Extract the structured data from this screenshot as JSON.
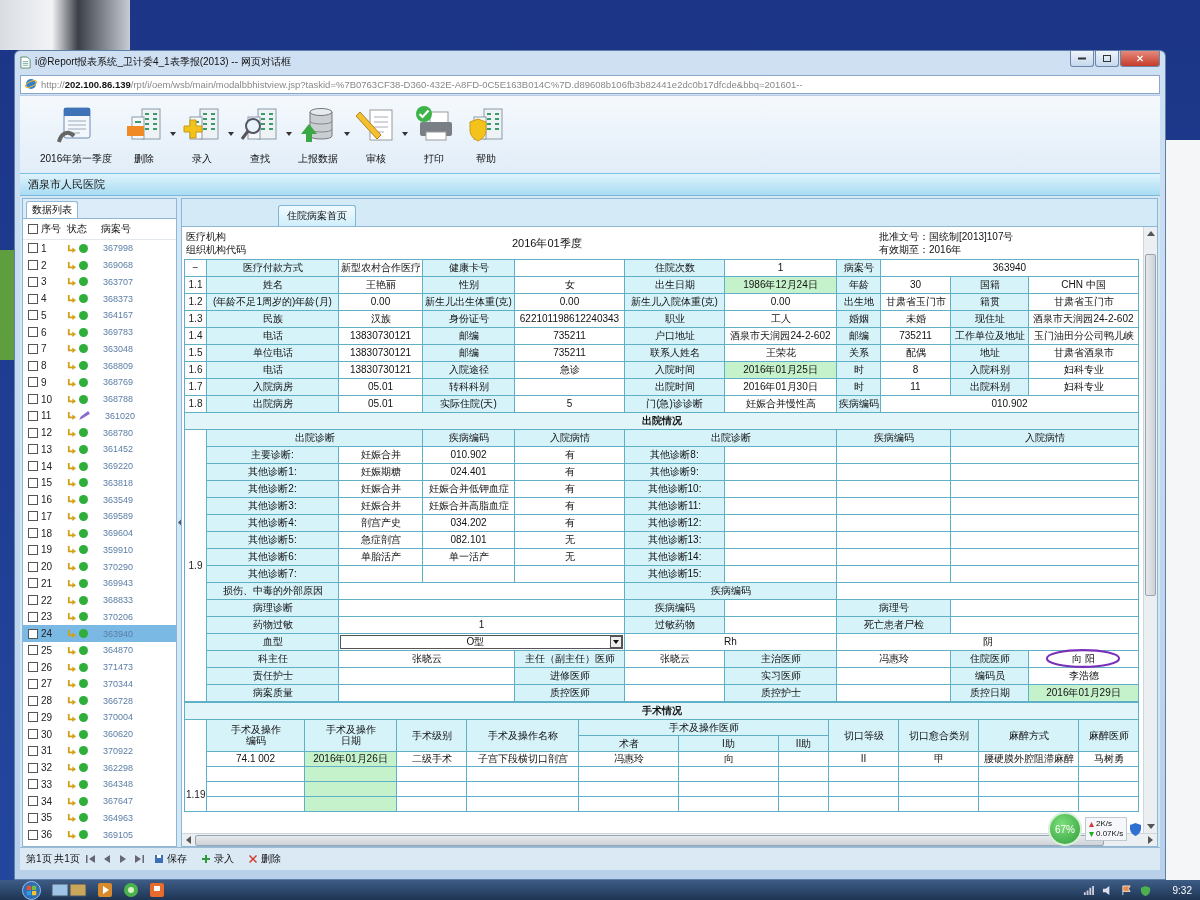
{
  "window": {
    "title": "i@Report报表系统_卫计委4_1表季报(2013) -- 网页对话框",
    "url": "http://**202.100.86.139**/rpt/i/oem/wsb/main/modalbbhistview.jsp?taskid=%7B0763CF38-D360-432E-A8FD-0C5E163B014C%7D.d89608b106fb3b82441e2dc0b17dfcde&bbq=201601--"
  },
  "toolbar": [
    {
      "label": "2016年第一季度",
      "dropdown": false
    },
    {
      "label": "删除",
      "dropdown": true
    },
    {
      "label": "录入",
      "dropdown": true
    },
    {
      "label": "查找",
      "dropdown": true
    },
    {
      "label": "上报数据",
      "dropdown": true
    },
    {
      "label": "审核",
      "dropdown": true
    },
    {
      "label": "打印",
      "dropdown": false
    },
    {
      "label": "帮助",
      "dropdown": false
    }
  ],
  "hospital": "酒泉市人民医院",
  "record_list": {
    "tab": "数据列表",
    "header_checked": false,
    "columns": [
      "序号",
      "状态",
      "病案号"
    ],
    "rows": [
      {
        "no": "1",
        "kind": "done",
        "record": "367998",
        "checked": false,
        "selected": false
      },
      {
        "no": "2",
        "kind": "done",
        "record": "369068",
        "checked": false,
        "selected": false
      },
      {
        "no": "3",
        "kind": "done",
        "record": "363707",
        "checked": false,
        "selected": false
      },
      {
        "no": "4",
        "kind": "done",
        "record": "368373",
        "checked": false,
        "selected": false
      },
      {
        "no": "5",
        "kind": "done",
        "record": "364167",
        "checked": false,
        "selected": false
      },
      {
        "no": "6",
        "kind": "done",
        "record": "369783",
        "checked": false,
        "selected": false
      },
      {
        "no": "7",
        "kind": "done",
        "record": "363048",
        "checked": false,
        "selected": false
      },
      {
        "no": "8",
        "kind": "done",
        "record": "368809",
        "checked": false,
        "selected": false
      },
      {
        "no": "9",
        "kind": "done",
        "record": "368769",
        "checked": false,
        "selected": false
      },
      {
        "no": "10",
        "kind": "done",
        "record": "368788",
        "checked": false,
        "selected": false
      },
      {
        "no": "11",
        "kind": "edit",
        "record": "361020",
        "checked": false,
        "selected": false
      },
      {
        "no": "12",
        "kind": "done",
        "record": "368780",
        "checked": false,
        "selected": false
      },
      {
        "no": "13",
        "kind": "done",
        "record": "361452",
        "checked": false,
        "selected": false
      },
      {
        "no": "14",
        "kind": "done",
        "record": "369220",
        "checked": false,
        "selected": false
      },
      {
        "no": "15",
        "kind": "done",
        "record": "363818",
        "checked": false,
        "selected": false
      },
      {
        "no": "16",
        "kind": "done",
        "record": "363549",
        "checked": false,
        "selected": false
      },
      {
        "no": "17",
        "kind": "done",
        "record": "369589",
        "checked": false,
        "selected": false
      },
      {
        "no": "18",
        "kind": "done",
        "record": "369604",
        "checked": false,
        "selected": false
      },
      {
        "no": "19",
        "kind": "done",
        "record": "359910",
        "checked": false,
        "selected": false
      },
      {
        "no": "20",
        "kind": "done",
        "record": "370290",
        "checked": false,
        "selected": false
      },
      {
        "no": "21",
        "kind": "done",
        "record": "369943",
        "checked": false,
        "selected": false
      },
      {
        "no": "22",
        "kind": "done",
        "record": "368833",
        "checked": false,
        "selected": false
      },
      {
        "no": "23",
        "kind": "done",
        "record": "370206",
        "checked": false,
        "selected": false
      },
      {
        "no": "24",
        "kind": "done",
        "record": "363940",
        "checked": false,
        "selected": true
      },
      {
        "no": "25",
        "kind": "done",
        "record": "364870",
        "checked": false,
        "selected": false
      },
      {
        "no": "26",
        "kind": "done",
        "record": "371473",
        "checked": false,
        "selected": false
      },
      {
        "no": "27",
        "kind": "done",
        "record": "370344",
        "checked": false,
        "selected": false
      },
      {
        "no": "28",
        "kind": "done",
        "record": "366728",
        "checked": false,
        "selected": false
      },
      {
        "no": "29",
        "kind": "done",
        "record": "370004",
        "checked": false,
        "selected": false
      },
      {
        "no": "30",
        "kind": "done",
        "record": "360620",
        "checked": false,
        "selected": false
      },
      {
        "no": "31",
        "kind": "done",
        "record": "370922",
        "checked": false,
        "selected": false
      },
      {
        "no": "32",
        "kind": "done",
        "record": "362298",
        "checked": false,
        "selected": false
      },
      {
        "no": "33",
        "kind": "done",
        "record": "364348",
        "checked": false,
        "selected": false
      },
      {
        "no": "34",
        "kind": "done",
        "record": "367647",
        "checked": false,
        "selected": false
      },
      {
        "no": "35",
        "kind": "done",
        "record": "364963",
        "checked": false,
        "selected": false
      },
      {
        "no": "36",
        "kind": "done",
        "record": "369105",
        "checked": false,
        "selected": false
      }
    ]
  },
  "report": {
    "tab": "住院病案首页",
    "org_label": "医疗机构",
    "org_code_label": "组织机构代码",
    "period": "2016年01季度",
    "approval": "批准文号：国统制[2013]107号",
    "valid_until": "有效期至：2016年",
    "basic": {
      "rows": [
        {
          "no": "−",
          "cells": [
            {
              "text": "医疗付款方式",
              "kind": "label"
            },
            {
              "text": "新型农村合作医疗",
              "kind": "value"
            },
            {
              "text": "健康卡号",
              "kind": "label"
            },
            {
              "kind": "value"
            },
            {
              "text": "住院次数",
              "kind": "label"
            },
            {
              "text": "1",
              "kind": "value"
            },
            {
              "text": "病案号",
              "kind": "label"
            },
            {
              "text": "363940",
              "kind": "value",
              "colspan": 3
            }
          ]
        },
        {
          "no": "1.1",
          "cells": [
            {
              "text": "姓名",
              "kind": "label"
            },
            {
              "text": "王艳丽",
              "kind": "value"
            },
            {
              "text": "性别",
              "kind": "label"
            },
            {
              "text": "女",
              "kind": "value"
            },
            {
              "text": "出生日期",
              "kind": "label"
            },
            {
              "text": "1986年12月24日",
              "kind": "highlight"
            },
            {
              "text": "年龄",
              "kind": "label"
            },
            {
              "text": "30",
              "kind": "value"
            },
            {
              "text": "国籍",
              "kind": "label"
            },
            {
              "text": "CHN 中国",
              "kind": "value"
            }
          ]
        },
        {
          "no": "1.2",
          "cells": [
            {
              "text": "(年龄不足1周岁的)年龄(月)",
              "kind": "label"
            },
            {
              "text": "0.00",
              "kind": "value"
            },
            {
              "text": "新生儿出生体重(克)",
              "kind": "label"
            },
            {
              "text": "0.00",
              "kind": "value"
            },
            {
              "text": "新生儿入院体重(克)",
              "kind": "label"
            },
            {
              "text": "0.00",
              "kind": "value"
            },
            {
              "text": "出生地",
              "kind": "label"
            },
            {
              "text": "甘肃省玉门市",
              "kind": "value"
            },
            {
              "text": "籍贯",
              "kind": "label"
            },
            {
              "text": "甘肃省玉门市",
              "kind": "value"
            }
          ]
        },
        {
          "no": "1.3",
          "cells": [
            {
              "text": "民族",
              "kind": "label"
            },
            {
              "text": "汉族",
              "kind": "value"
            },
            {
              "text": "身份证号",
              "kind": "label"
            },
            {
              "text": "622101198612240343",
              "kind": "value"
            },
            {
              "text": "职业",
              "kind": "label"
            },
            {
              "text": "工人",
              "kind": "value"
            },
            {
              "text": "婚姻",
              "kind": "label"
            },
            {
              "text": "未婚",
              "kind": "value"
            },
            {
              "text": "现住址",
              "kind": "label"
            },
            {
              "text": "酒泉市天润园24-2-602",
              "kind": "value"
            }
          ]
        },
        {
          "no": "1.4",
          "cells": [
            {
              "text": "电话",
              "kind": "label"
            },
            {
              "text": "13830730121",
              "kind": "value"
            },
            {
              "text": "邮编",
              "kind": "label"
            },
            {
              "text": "735211",
              "kind": "value"
            },
            {
              "text": "户口地址",
              "kind": "label"
            },
            {
              "text": "酒泉市天润园24-2-602",
              "kind": "value"
            },
            {
              "text": "邮编",
              "kind": "label"
            },
            {
              "text": "735211",
              "kind": "value"
            },
            {
              "text": "工作单位及地址",
              "kind": "label"
            },
            {
              "text": "玉门油田分公司鸭儿峡",
              "kind": "value"
            }
          ]
        },
        {
          "no": "1.5",
          "cells": [
            {
              "text": "单位电话",
              "kind": "label"
            },
            {
              "text": "13830730121",
              "kind": "value"
            },
            {
              "text": "邮编",
              "kind": "label"
            },
            {
              "text": "735211",
              "kind": "value"
            },
            {
              "text": "联系人姓名",
              "kind": "label"
            },
            {
              "text": "王荣花",
              "kind": "value"
            },
            {
              "text": "关系",
              "kind": "label"
            },
            {
              "text": "配偶",
              "kind": "value"
            },
            {
              "text": "地址",
              "kind": "label"
            },
            {
              "text": "甘肃省酒泉市",
              "kind": "value"
            }
          ]
        },
        {
          "no": "1.6",
          "cells": [
            {
              "text": "电话",
              "kind": "label"
            },
            {
              "text": "13830730121",
              "kind": "value"
            },
            {
              "text": "入院途径",
              "kind": "label"
            },
            {
              "text": "急诊",
              "kind": "value"
            },
            {
              "text": "入院时间",
              "kind": "label"
            },
            {
              "text": "2016年01月25日",
              "kind": "highlight"
            },
            {
              "text": "时",
              "kind": "label"
            },
            {
              "text": "8",
              "kind": "value"
            },
            {
              "text": "入院科别",
              "kind": "label"
            },
            {
              "text": "妇科专业",
              "kind": "value"
            }
          ]
        },
        {
          "no": "1.7",
          "cells": [
            {
              "text": "入院病房",
              "kind": "label"
            },
            {
              "text": "05.01",
              "kind": "value"
            },
            {
              "text": "转科科别",
              "kind": "label"
            },
            {
              "kind": "value"
            },
            {
              "text": "出院时间",
              "kind": "label"
            },
            {
              "text": "2016年01月30日",
              "kind": "value"
            },
            {
              "text": "时",
              "kind": "label"
            },
            {
              "text": "11",
              "kind": "value"
            },
            {
              "text": "出院科别",
              "kind": "label"
            },
            {
              "text": "妇科专业",
              "kind": "value"
            }
          ]
        },
        {
          "no": "1.8",
          "cells": [
            {
              "text": "出院病房",
              "kind": "label"
            },
            {
              "text": "05.01",
              "kind": "value"
            },
            {
              "text": "实际住院(天)",
              "kind": "label"
            },
            {
              "text": "5",
              "kind": "value"
            },
            {
              "text": "门(急)诊诊断",
              "kind": "label"
            },
            {
              "text": "妊娠合并慢性高",
              "kind": "value"
            },
            {
              "text": "疾病编码",
              "kind": "label"
            },
            {
              "text": "010.902",
              "kind": "value",
              "colspan": 3
            }
          ]
        }
      ]
    },
    "discharge": {
      "title": "出院情况",
      "row_no": "1.9",
      "rows": [
        {
          "cells": [
            {
              "text": "出院诊断",
              "kind": "label",
              "colspan": 2
            },
            {
              "text": "疾病编码",
              "kind": "label"
            },
            {
              "text": "入院病情",
              "kind": "label"
            },
            {
              "text": "出院诊断",
              "kind": "label",
              "colspan": 2
            },
            {
              "text": "疾病编码",
              "kind": "label",
              "colspan": 2
            },
            {
              "text": "入院病情",
              "kind": "label",
              "colspan": 2
            }
          ]
        },
        {
          "cells": [
            {
              "text": "主要诊断:",
              "kind": "label"
            },
            {
              "text": "妊娠合并",
              "kind": "value"
            },
            {
              "text": "010.902",
              "kind": "value"
            },
            {
              "text": "有",
              "kind": "value"
            },
            {
              "text": "其他诊断8:",
              "kind": "label"
            },
            {
              "kind": "value"
            },
            {
              "kind": "value",
              "colspan": 2
            },
            {
              "kind": "value",
              "colspan": 2
            }
          ]
        },
        {
          "cells": [
            {
              "text": "其他诊断1:",
              "kind": "label"
            },
            {
              "text": "妊娠期糖",
              "kind": "value"
            },
            {
              "text": "024.401",
              "kind": "value"
            },
            {
              "text": "有",
              "kind": "value"
            },
            {
              "text": "其他诊断9:",
              "kind": "label"
            },
            {
              "kind": "value"
            },
            {
              "kind": "value",
              "colspan": 2
            },
            {
              "kind": "value",
              "colspan": 2
            }
          ]
        },
        {
          "cells": [
            {
              "text": "其他诊断2:",
              "kind": "label"
            },
            {
              "text": "妊娠合并",
              "kind": "value"
            },
            {
              "text": "妊娠合并低钾血症",
              "kind": "value"
            },
            {
              "text": "有",
              "kind": "value"
            },
            {
              "text": "其他诊断10:",
              "kind": "label"
            },
            {
              "kind": "value"
            },
            {
              "kind": "value",
              "colspan": 2
            },
            {
              "kind": "value",
              "colspan": 2
            }
          ]
        },
        {
          "cells": [
            {
              "text": "其他诊断3:",
              "kind": "label"
            },
            {
              "text": "妊娠合并",
              "kind": "value"
            },
            {
              "text": "妊娠合并高脂血症",
              "kind": "value"
            },
            {
              "text": "有",
              "kind": "value"
            },
            {
              "text": "其他诊断11:",
              "kind": "label"
            },
            {
              "kind": "value"
            },
            {
              "kind": "value",
              "colspan": 2
            },
            {
              "kind": "value",
              "colspan": 2
            }
          ]
        },
        {
          "cells": [
            {
              "text": "其他诊断4:",
              "kind": "label"
            },
            {
              "text": "剖宫产史",
              "kind": "value"
            },
            {
              "text": "034.202",
              "kind": "value"
            },
            {
              "text": "有",
              "kind": "value"
            },
            {
              "text": "其他诊断12:",
              "kind": "label"
            },
            {
              "kind": "value"
            },
            {
              "kind": "value",
              "colspan": 2
            },
            {
              "kind": "value",
              "colspan": 2
            }
          ]
        },
        {
          "cells": [
            {
              "text": "其他诊断5:",
              "kind": "label"
            },
            {
              "text": "急症剖宫",
              "kind": "value"
            },
            {
              "text": "082.101",
              "kind": "value"
            },
            {
              "text": "无",
              "kind": "value"
            },
            {
              "text": "其他诊断13:",
              "kind": "label"
            },
            {
              "kind": "value"
            },
            {
              "kind": "value",
              "colspan": 2
            },
            {
              "kind": "value",
              "colspan": 2
            }
          ]
        },
        {
          "cells": [
            {
              "text": "其他诊断6:",
              "kind": "label"
            },
            {
              "text": "单胎活产",
              "kind": "value"
            },
            {
              "text": "单一活产",
              "kind": "value"
            },
            {
              "text": "无",
              "kind": "value"
            },
            {
              "text": "其他诊断14:",
              "kind": "label"
            },
            {
              "kind": "value"
            },
            {
              "kind": "value",
              "colspan": 2
            },
            {
              "kind": "value",
              "colspan": 2
            }
          ]
        },
        {
          "cells": [
            {
              "text": "其他诊断7:",
              "kind": "label"
            },
            {
              "kind": "value"
            },
            {
              "kind": "value"
            },
            {
              "kind": "value"
            },
            {
              "text": "其他诊断15:",
              "kind": "label"
            },
            {
              "kind": "value"
            },
            {
              "kind": "value",
              "colspan": 2
            },
            {
              "kind": "value",
              "colspan": 2
            }
          ]
        },
        {
          "cells": [
            {
              "text": "损伤、中毒的外部原因",
              "kind": "label"
            },
            {
              "kind": "value",
              "colspan": 3
            },
            {
              "text": "疾病编码",
              "kind": "label",
              "colspan": 2
            },
            {
              "kind": "value",
              "colspan": 4
            }
          ]
        },
        {
          "cells": [
            {
              "text": "病理诊断",
              "kind": "label"
            },
            {
              "kind": "value",
              "colspan": 3
            },
            {
              "text": "疾病编码",
              "kind": "label"
            },
            {
              "kind": "value"
            },
            {
              "text": "病理号",
              "kind": "label",
              "colspan": 2
            },
            {
              "kind": "value",
              "colspan": 2
            }
          ]
        },
        {
          "cells": [
            {
              "text": "药物过敏",
              "kind": "label"
            },
            {
              "text": "1",
              "kind": "value",
              "colspan": 3
            },
            {
              "text": "过敏药物",
              "kind": "label"
            },
            {
              "kind": "value"
            },
            {
              "text": "死亡患者尸检",
              "kind": "label",
              "colspan": 2
            },
            {
              "kind": "value",
              "colspan": 2
            }
          ]
        },
        {
          "cells": [
            {
              "text": "血型",
              "kind": "label"
            },
            {
              "text": "O型",
              "kind": "select",
              "colspan": 3
            },
            {
              "text": "Rh",
              "kind": "value",
              "colspan": 2
            },
            {
              "text": "阴",
              "kind": "value",
              "colspan": 4
            }
          ]
        },
        {
          "cells": [
            {
              "text": "科主任",
              "kind": "label"
            },
            {
              "text": "张晓云",
              "kind": "value",
              "colspan": 2
            },
            {
              "text": "主任（副主任）医师",
              "kind": "label"
            },
            {
              "text": "张晓云",
              "kind": "value"
            },
            {
              "text": "主治医师",
              "kind": "label"
            },
            {
              "text": "冯惠玲",
              "kind": "value",
              "colspan": 2
            },
            {
              "text": "住院医师",
              "kind": "label"
            },
            {
              "text": "向 阳",
              "kind": "value",
              "circled": true
            }
          ]
        },
        {
          "cells": [
            {
              "text": "责任护士",
              "kind": "label"
            },
            {
              "kind": "value",
              "colspan": 2
            },
            {
              "text": "进修医师",
              "kind": "label"
            },
            {
              "kind": "value"
            },
            {
              "text": "实习医师",
              "kind": "label"
            },
            {
              "kind": "value",
              "colspan": 2
            },
            {
              "text": "编码员",
              "kind": "label"
            },
            {
              "text": "李浩德",
              "kind": "value"
            }
          ]
        },
        {
          "cells": [
            {
              "text": "病案质量",
              "kind": "label"
            },
            {
              "kind": "value",
              "colspan": 2
            },
            {
              "text": "质控医师",
              "kind": "label"
            },
            {
              "kind": "value"
            },
            {
              "text": "质控护士",
              "kind": "label"
            },
            {
              "kind": "value",
              "colspan": 2
            },
            {
              "text": "质控日期",
              "kind": "label"
            },
            {
              "text": "2016年01月29日",
              "kind": "highlight"
            }
          ]
        }
      ]
    },
    "surgery": {
      "title": "手术情况",
      "row_no": "1.19",
      "columns": [
        {
          "label": "手术及操作编码"
        },
        {
          "label": "手术及操作日期"
        },
        {
          "label": "手术级别"
        },
        {
          "label": "手术及操作名称"
        },
        {
          "label": "手术及操作医师",
          "colspan": 3,
          "children": [
            "术者",
            "I助",
            "II助"
          ]
        },
        {
          "label": "切口等级"
        },
        {
          "label": "切口愈合类别"
        },
        {
          "label": "麻醉方式"
        },
        {
          "label": "麻醉医师"
        }
      ],
      "rows": [
        {
          "cells": [
            {
              "text": "74.1 002",
              "kind": "value"
            },
            {
              "text": "2016年01月26日",
              "kind": "highlight"
            },
            {
              "text": "二级手术",
              "kind": "value"
            },
            {
              "text": "子宫下段横切口剖宫",
              "kind": "value"
            },
            {
              "text": "冯惠玲",
              "kind": "value"
            },
            {
              "text": "向",
              "kind": "value"
            },
            {
              "kind": "value"
            },
            {
              "text": "II",
              "kind": "value"
            },
            {
              "text": "甲",
              "kind": "value"
            },
            {
              "text": "腰硬膜外腔阻滞麻醉",
              "kind": "value"
            },
            {
              "text": "马树勇",
              "kind": "value"
            }
          ]
        }
      ]
    }
  },
  "status_bar": {
    "page_info": "第1页 共1页",
    "actions": [
      "保存",
      "录入",
      "删除"
    ]
  },
  "net_widget": {
    "percent": "67%",
    "upload": "2K/s",
    "download": "0.07K/s"
  },
  "taskbar": {
    "clock": "9:32"
  }
}
